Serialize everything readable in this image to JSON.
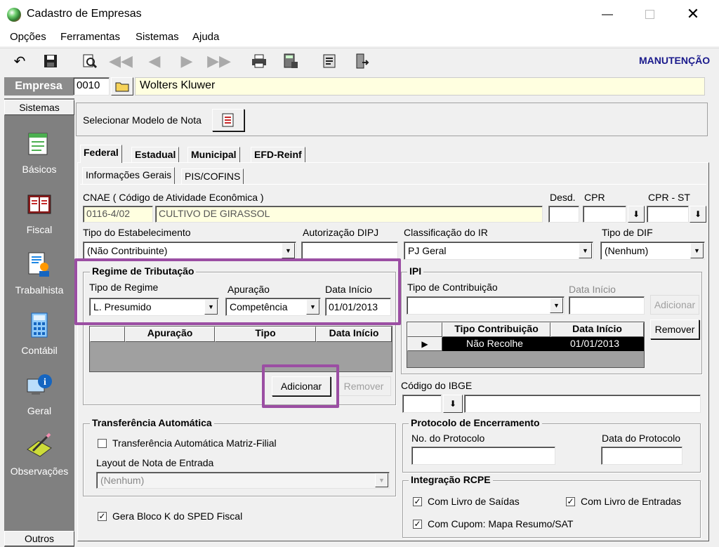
{
  "window": {
    "title": "Cadastro de Empresas"
  },
  "menu": [
    "Opções",
    "Ferramentas",
    "Sistemas",
    "Ajuda"
  ],
  "toolbar": {
    "mode": "MANUTENÇÃO"
  },
  "empresa": {
    "label": "Empresa",
    "code": "0010",
    "name": "Wolters Kluwer"
  },
  "sidebar": {
    "header": "Sistemas",
    "items": [
      "Básicos",
      "Fiscal",
      "Trabalhista",
      "Contábil",
      "Geral",
      "Observações"
    ],
    "footer": "Outros"
  },
  "modelo": {
    "label": "Selecionar Modelo de Nota"
  },
  "tabs": [
    "Federal",
    "Estadual",
    "Municipal",
    "EFD-Reinf"
  ],
  "subtabs": [
    "Informações Gerais",
    "PIS/COFINS"
  ],
  "cnae": {
    "label": "CNAE ( Código de  Atividade Econômica )",
    "code": "0116-4/02",
    "desc": "CULTIVO DE GIRASSOL"
  },
  "desd": {
    "label": "Desd."
  },
  "cpr": {
    "label": "CPR"
  },
  "cpr_st": {
    "label": "CPR - ST"
  },
  "tipo_estab": {
    "label": "Tipo do Estabelecimento",
    "value": "(Não Contribuinte)"
  },
  "aut_dipj": {
    "label": "Autorização DIPJ"
  },
  "class_ir": {
    "label": "Classificação do IR",
    "value": "PJ Geral"
  },
  "tipo_dif": {
    "label": "Tipo de DIF",
    "value": "(Nenhum)"
  },
  "regime": {
    "title": "Regime de Tributação",
    "tipo_label": "Tipo de Regime",
    "tipo_value": "L. Presumido",
    "apur_label": "Apuração",
    "apur_value": "Competência",
    "data_label": "Data Início",
    "data_value": "01/01/2013",
    "cols": [
      "Apuração",
      "Tipo",
      "Data Início"
    ],
    "add": "Adicionar",
    "remove": "Remover"
  },
  "ipi": {
    "title": "IPI",
    "tipo_label": "Tipo de Contribuição",
    "data_label": "Data Início",
    "add": "Adicionar",
    "remove": "Remover",
    "cols": [
      "Tipo Contribuição",
      "Data Início"
    ],
    "row": {
      "tipo": "Não Recolhe",
      "data": "01/01/2013"
    }
  },
  "ibge": {
    "label": "Código do IBGE"
  },
  "transf": {
    "title": "Transferência Automática",
    "check_label": "Transferência Automática Matriz-Filial",
    "layout_label": "Layout de Nota de Entrada",
    "layout_value": "(Nenhum)"
  },
  "bloco_k": {
    "label": "Gera Bloco K do SPED Fiscal"
  },
  "protocolo": {
    "title": "Protocolo de Encerramento",
    "num_label": "No. do Protocolo",
    "data_label": "Data do Protocolo"
  },
  "rcpe": {
    "title": "Integração RCPE",
    "saidas": "Com Livro de Saídas",
    "entradas": "Com Livro de Entradas",
    "cupom": "Com Cupom: Mapa Resumo/SAT"
  },
  "colors": {
    "accent": "#9b4ea3",
    "sidebar": "#808080",
    "title_blue": "#1a1a8c",
    "yellow_field": "#ffffe0"
  }
}
